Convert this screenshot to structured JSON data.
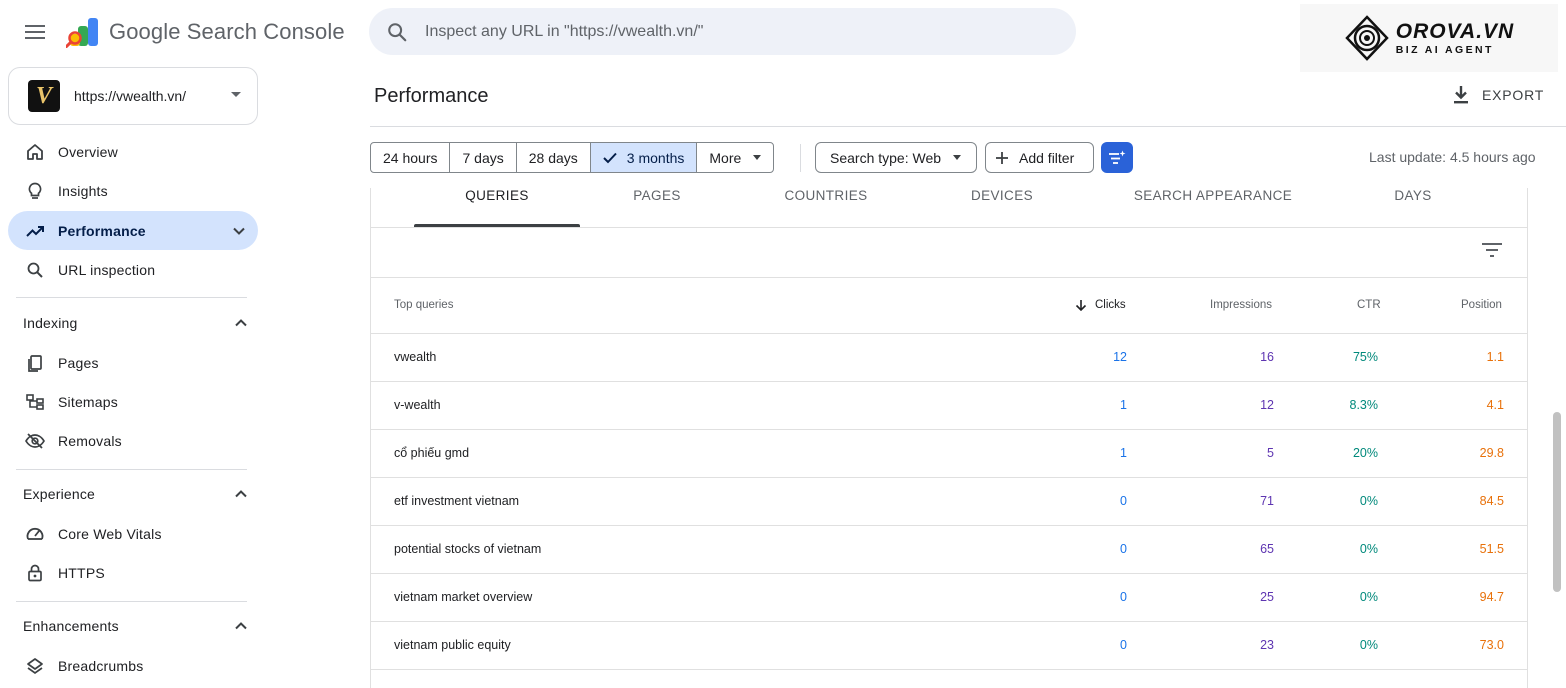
{
  "app": {
    "title": "Google Search Console",
    "search_placeholder": "Inspect any URL in \"https://vwealth.vn/\"",
    "brand_name": "OROVA.VN",
    "brand_tagline": "BIZ AI AGENT"
  },
  "property": {
    "url": "https://vwealth.vn/",
    "logo_letter": "V"
  },
  "sidebar": {
    "primary": [
      {
        "label": "Overview",
        "icon": "home-icon"
      },
      {
        "label": "Insights",
        "icon": "lightbulb-icon"
      },
      {
        "label": "Performance",
        "icon": "trending-up-icon",
        "active": true
      },
      {
        "label": "URL inspection",
        "icon": "search-icon"
      }
    ],
    "sections": [
      {
        "title": "Indexing",
        "items": [
          {
            "label": "Pages",
            "icon": "pages-icon"
          },
          {
            "label": "Sitemaps",
            "icon": "sitemap-icon"
          },
          {
            "label": "Removals",
            "icon": "eye-off-icon"
          }
        ]
      },
      {
        "title": "Experience",
        "items": [
          {
            "label": "Core Web Vitals",
            "icon": "speed-icon"
          },
          {
            "label": "HTTPS",
            "icon": "lock-icon"
          }
        ]
      },
      {
        "title": "Enhancements",
        "items": [
          {
            "label": "Breadcrumbs",
            "icon": "layers-icon"
          }
        ]
      }
    ]
  },
  "header": {
    "page_title": "Performance",
    "export_label": "EXPORT"
  },
  "toolbar": {
    "ranges": [
      "24 hours",
      "7 days",
      "28 days",
      "3 months",
      "More"
    ],
    "selected_range": "3 months",
    "search_type": "Search type: Web",
    "add_filter": "Add filter",
    "last_update": "Last update: 4.5 hours ago"
  },
  "tabs": [
    "QUERIES",
    "PAGES",
    "COUNTRIES",
    "DEVICES",
    "SEARCH APPEARANCE",
    "DAYS"
  ],
  "active_tab": "QUERIES",
  "table": {
    "columns": [
      "Top queries",
      "Clicks",
      "Impressions",
      "CTR",
      "Position"
    ],
    "sorted_column": "Clicks",
    "rows": [
      [
        "vwealth",
        "12",
        "16",
        "75%",
        "1.1"
      ],
      [
        "v-wealth",
        "1",
        "12",
        "8.3%",
        "4.1"
      ],
      [
        "cổ phiếu gmd",
        "1",
        "5",
        "20%",
        "29.8"
      ],
      [
        "etf investment vietnam",
        "0",
        "71",
        "0%",
        "84.5"
      ],
      [
        "potential stocks of vietnam",
        "0",
        "65",
        "0%",
        "51.5"
      ],
      [
        "vietnam market overview",
        "0",
        "25",
        "0%",
        "94.7"
      ],
      [
        "vietnam public equity",
        "0",
        "23",
        "0%",
        "73.0"
      ]
    ]
  },
  "colors": {
    "clicks": "#1a73e8",
    "impressions": "#5e35b1",
    "ctr": "#00897b",
    "position": "#e8710a",
    "active_bg": "#d3e3fd",
    "accent": "#2a62d8"
  }
}
